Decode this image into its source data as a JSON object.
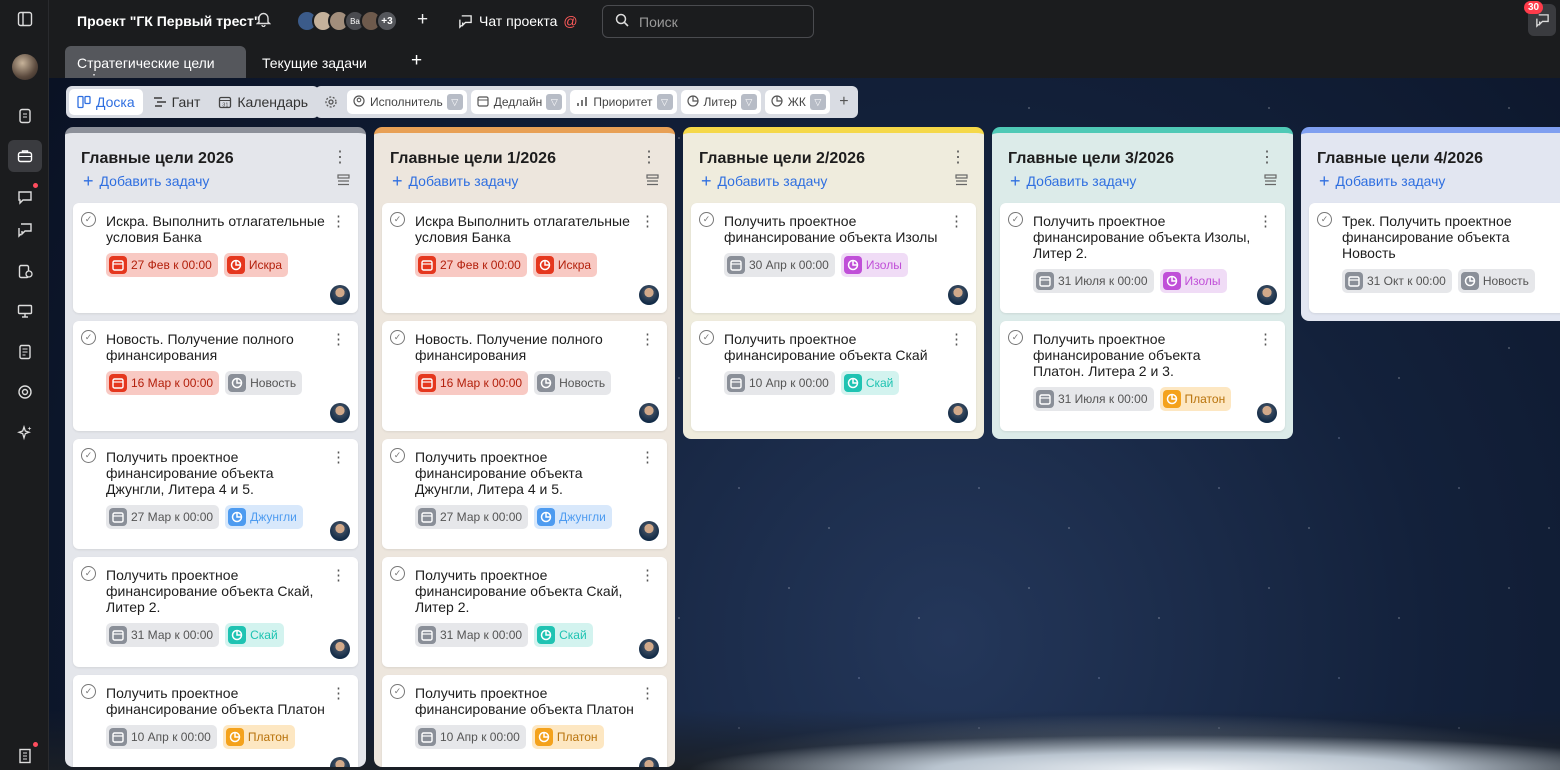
{
  "app": {
    "project_title": "Проект \"ГК Первый трест\"",
    "avatars_extra": "+3",
    "avatar_initials": "Ва",
    "chat_label": "Чат проекта",
    "chat_mention": "@",
    "search_placeholder": "Поиск",
    "notifications_count": "30"
  },
  "rail": [
    "collapse-panel-icon",
    "tasks-icon",
    "briefcase-icon",
    "chat-icon",
    "messages-icon",
    "reports-icon",
    "presentation-icon",
    "docs-icon",
    "support-icon",
    "ai-sparkle-icon",
    "building-icon"
  ],
  "tabs": [
    {
      "label": "Стратегические цели",
      "active": true
    },
    {
      "label": "Текущие задачи",
      "active": false
    }
  ],
  "views": [
    {
      "label": "Доска",
      "icon": "board-icon",
      "active": true
    },
    {
      "label": "Гант",
      "icon": "gantt-icon",
      "active": false
    },
    {
      "label": "Календарь",
      "icon": "calendar-icon",
      "active": false
    }
  ],
  "filters": [
    {
      "label": "Исполнитель",
      "icon": "user-icon"
    },
    {
      "label": "Дедлайн",
      "icon": "calendar-icon"
    },
    {
      "label": "Приоритет",
      "icon": "priority-icon"
    },
    {
      "label": "Литер",
      "icon": "pie-icon"
    },
    {
      "label": "ЖК",
      "icon": "pie-icon"
    }
  ],
  "add_task_label": "Добавить задачу",
  "colors": {
    "red_bg": "#f8c9c3",
    "red_icon": "#e5371e",
    "gray_bg": "#e6e7ea",
    "gray_icon": "#8a8f98",
    "purple_bg": "#f0dcf6",
    "purple_icon": "#c04fd8",
    "blue_bg": "#d8e8fb",
    "blue_icon": "#4d9bf0",
    "teal_bg": "#d3f3ef",
    "teal_icon": "#1fc3b2",
    "orange_bg": "#fde7c2",
    "orange_icon": "#f4a21c"
  },
  "columns": [
    {
      "title": "Главные цели 2026",
      "accent": "#8c9099",
      "bg": "#e4e6eb",
      "cards": [
        {
          "title": "Искра. Выполнить отлагательные условия Банка",
          "date": "27 Фев к 00:00",
          "date_style": "red",
          "tag": "Искра",
          "tag_style": "red"
        },
        {
          "title": "Новость. Получение полного финансирования",
          "date": "16 Мар к 00:00",
          "date_style": "red",
          "tag": "Новость",
          "tag_style": "gray"
        },
        {
          "title": "Получить проектное финансирование объекта Джунгли, Литера 4 и 5.",
          "date": "27 Мар к 00:00",
          "date_style": "gray",
          "tag": "Джунгли",
          "tag_style": "blue"
        },
        {
          "title": "Получить проектное финансирование объекта Скай, Литер 2.",
          "date": "31 Мар к 00:00",
          "date_style": "gray",
          "tag": "Скай",
          "tag_style": "teal"
        },
        {
          "title": "Получить проектное финансирование объекта Платон",
          "date": "10 Апр к 00:00",
          "date_style": "gray",
          "tag": "Платон",
          "tag_style": "orange"
        }
      ]
    },
    {
      "title": "Главные цели 1/2026",
      "accent": "#e8a055",
      "bg": "#ede6dd",
      "cards": [
        {
          "title": "Искра Выполнить отлагательные условия Банка",
          "date": "27 Фев к 00:00",
          "date_style": "red",
          "tag": "Искра",
          "tag_style": "red"
        },
        {
          "title": "Новость. Получение полного финансирования",
          "date": "16 Мар к 00:00",
          "date_style": "red",
          "tag": "Новость",
          "tag_style": "gray"
        },
        {
          "title": "Получить проектное финансирование объекта Джунгли, Литера 4 и 5.",
          "date": "27 Мар к 00:00",
          "date_style": "gray",
          "tag": "Джунгли",
          "tag_style": "blue"
        },
        {
          "title": "Получить проектное финансирование объекта Скай, Литер 2.",
          "date": "31 Мар к 00:00",
          "date_style": "gray",
          "tag": "Скай",
          "tag_style": "teal"
        },
        {
          "title": "Получить проектное финансирование объекта Платон",
          "date": "10 Апр к 00:00",
          "date_style": "gray",
          "tag": "Платон",
          "tag_style": "orange"
        }
      ]
    },
    {
      "title": "Главные цели 2/2026",
      "accent": "#f5d848",
      "bg": "#efecdd",
      "cards": [
        {
          "title": "Получить проектное финансирование объекта Изолы",
          "date": "30 Апр к 00:00",
          "date_style": "gray",
          "tag": "Изолы",
          "tag_style": "purple"
        },
        {
          "title": "Получить проектное финансирование объекта Скай",
          "date": "10 Апр к 00:00",
          "date_style": "gray",
          "tag": "Скай",
          "tag_style": "teal"
        }
      ]
    },
    {
      "title": "Главные цели 3/2026",
      "accent": "#4fc9b6",
      "bg": "#dcebe9",
      "cards": [
        {
          "title": "Получить проектное финансирование объекта Изолы, Литер 2.",
          "date": "31 Июля к 00:00",
          "date_style": "gray",
          "tag": "Изолы",
          "tag_style": "purple"
        },
        {
          "title": "Получить проектное финансирование объекта Платон. Литера 2 и 3.",
          "date": "31 Июля к 00:00",
          "date_style": "gray",
          "tag": "Платон",
          "tag_style": "orange"
        }
      ]
    },
    {
      "title": "Главные цели 4/2026",
      "accent": "#7f9ff0",
      "bg": "#e2e6f1",
      "cards": [
        {
          "title": "Трек. Получить проектное финансирование объекта Новость",
          "date": "31 Окт к 00:00",
          "date_style": "gray",
          "tag": "Новость",
          "tag_style": "gray"
        }
      ]
    }
  ]
}
